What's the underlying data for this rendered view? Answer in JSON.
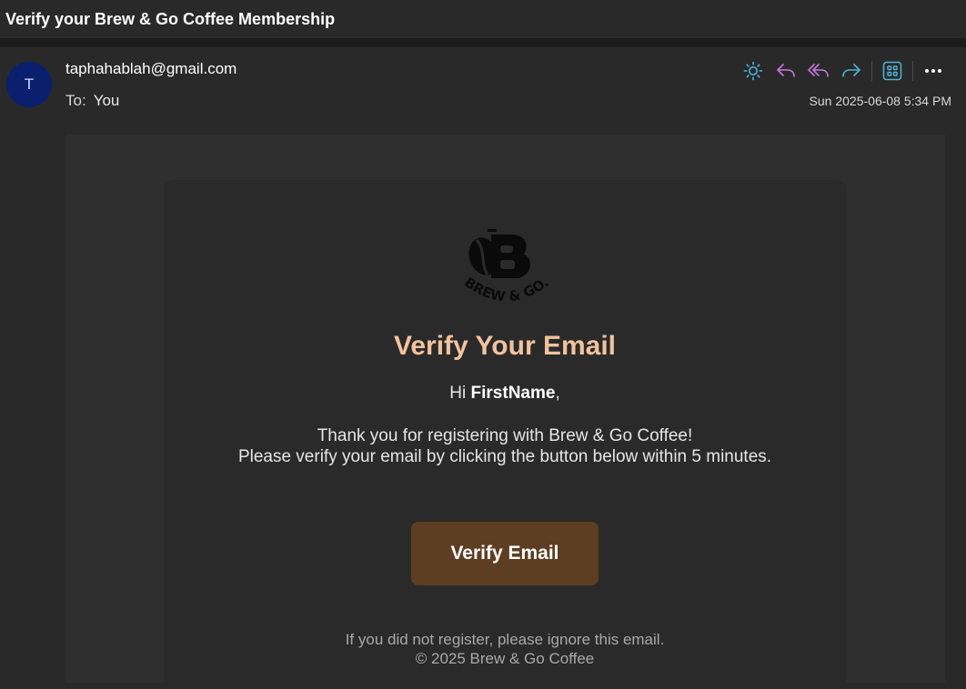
{
  "subject": "Verify your Brew & Go Coffee Membership",
  "header": {
    "avatar_initial": "T",
    "sender": "taphahablah@gmail.com",
    "to_label": "To:",
    "to_value": "You",
    "date": "Sun 2025-06-08 5:34 PM",
    "toolbar": [
      {
        "icon": "sun-icon",
        "color": "#4fb3d9"
      },
      {
        "icon": "reply-icon",
        "color": "#c678dd"
      },
      {
        "icon": "reply-all-icon",
        "color": "#c678dd"
      },
      {
        "icon": "forward-icon",
        "color": "#4fb3d9"
      },
      {
        "icon": "apps-icon",
        "color": "#4fb3d9"
      },
      {
        "icon": "more-icon",
        "color": "#ffffff"
      }
    ]
  },
  "email": {
    "logo_text": "BREW & GO.",
    "heading": "Verify Your Email",
    "greeting_prefix": "Hi ",
    "greeting_name": "FirstName",
    "greeting_suffix": ",",
    "line1": "Thank you for registering with Brew & Go Coffee!",
    "line2": "Please verify your email by clicking the button below within 5 minutes.",
    "button_label": "Verify Email",
    "footer_line1": "If you did not register, please ignore this email.",
    "footer_line2": "© 2025 Brew & Go Coffee"
  },
  "colors": {
    "heading": "#f2c29e",
    "button": "#5e3e23",
    "avatar": "#0a1f6e"
  }
}
